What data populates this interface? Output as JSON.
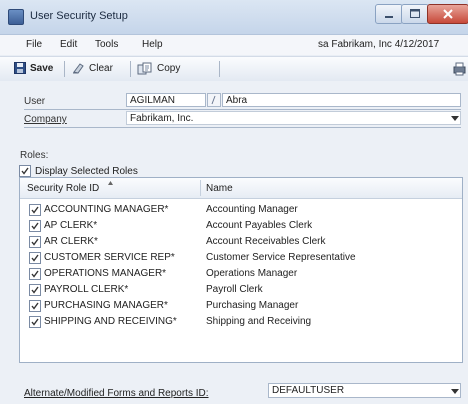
{
  "window": {
    "title": "User Security Setup",
    "controls": {
      "minimize": "minimize",
      "maximize": "maximize",
      "close": "close"
    }
  },
  "menu": {
    "items": [
      "File",
      "Edit",
      "Tools",
      "Help"
    ],
    "company_date": "sa  Fabrikam, Inc  4/12/2017"
  },
  "toolbar": {
    "save_label": "Save",
    "clear_label": "Clear",
    "copy_label": "Copy"
  },
  "form": {
    "user_label": "User",
    "user_id": "AGILMAN",
    "user_name": "Abra",
    "company_label": "Company",
    "company_value": "Fabrikam, Inc.",
    "roles_label": "Roles:",
    "display_selected_label": "Display Selected Roles",
    "display_selected_checked": true
  },
  "roles_table": {
    "columns": [
      "Security Role ID",
      "Name"
    ],
    "rows": [
      {
        "id": "ACCOUNTING MANAGER*",
        "name": "Accounting Manager",
        "checked": true
      },
      {
        "id": "AP CLERK*",
        "name": "Account Payables Clerk",
        "checked": true
      },
      {
        "id": "AR CLERK*",
        "name": "Account Receivables Clerk",
        "checked": true
      },
      {
        "id": "CUSTOMER SERVICE REP*",
        "name": "Customer Service Representative",
        "checked": true
      },
      {
        "id": "OPERATIONS MANAGER*",
        "name": "Operations Manager",
        "checked": true
      },
      {
        "id": "PAYROLL CLERK*",
        "name": "Payroll Clerk",
        "checked": true
      },
      {
        "id": "PURCHASING MANAGER*",
        "name": "Purchasing Manager",
        "checked": true
      },
      {
        "id": "SHIPPING AND RECEIVING*",
        "name": "Shipping and Receiving",
        "checked": true
      }
    ]
  },
  "footer": {
    "alt_forms_label": "Alternate/Modified Forms and Reports ID:",
    "alt_forms_value": "DEFAULTUSER"
  },
  "colors": {
    "titlebar": "#c5d5ea",
    "close": "#c7493a",
    "background": "#ecf0f6"
  }
}
